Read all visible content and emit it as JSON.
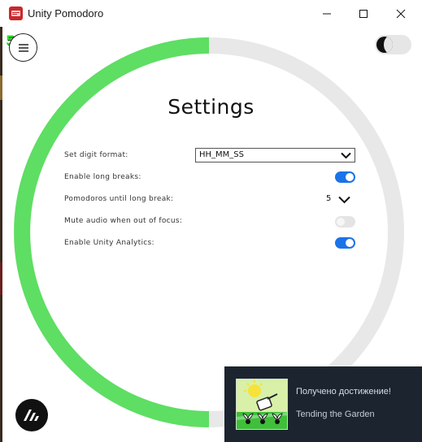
{
  "window": {
    "title": "Unity Pomodoro",
    "controls": [
      "minimize-icon",
      "maximize-icon",
      "close-icon"
    ]
  },
  "overlay": {
    "fps_counter": "55"
  },
  "timer_ring": {
    "progress_fraction": 0.5,
    "progress_color": "#5ede63",
    "track_color": "#e8e8e8"
  },
  "toolbar": {
    "menu_icon": "hamburger-icon",
    "theme_toggle_icon": "half-moon-icon"
  },
  "settings": {
    "heading": "Settings",
    "digit_format": {
      "label": "Set digit format:",
      "value": "HH_MM_SS"
    },
    "long_breaks": {
      "label": "Enable long breaks:",
      "enabled": true
    },
    "pomodoros_until_long_break": {
      "label": "Pomodoros until long break:",
      "value": "5"
    },
    "mute_audio": {
      "label": "Mute audio when out of focus:",
      "enabled": false
    },
    "analytics": {
      "label": "Enable Unity Analytics:",
      "enabled": true
    }
  },
  "colors": {
    "accent": "#1a73e8",
    "ring_green": "#5ede63"
  },
  "notification": {
    "title": "Получено достижение!",
    "achievement": "Tending the Garden"
  }
}
